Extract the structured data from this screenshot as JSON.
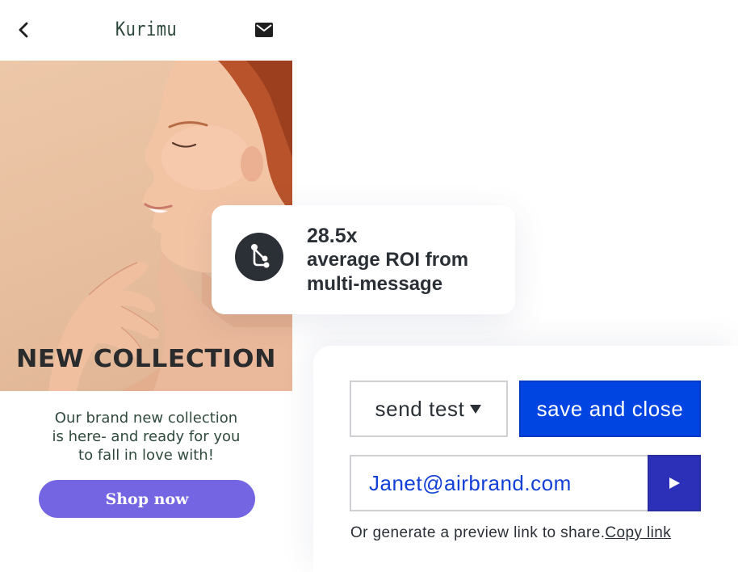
{
  "email_preview": {
    "brand": "Kurimu",
    "hero_title": "NEW COLLECTION",
    "body_lines": [
      "Our brand new collection",
      "is here- and ready for you",
      "to fall in love with!"
    ],
    "cta_label": "Shop now"
  },
  "roi_card": {
    "value": "28.5x",
    "description_lines": [
      "average ROI from",
      "multi-message"
    ]
  },
  "test_panel": {
    "send_test_label": "send test",
    "save_close_label": "save and close",
    "email_value": "Janet@airbrand.com",
    "preview_text": "Or generate a preview link to share.",
    "copy_link_label": "Copy link"
  },
  "icons": {
    "back": "chevron-left-icon",
    "mail": "envelope-icon",
    "roi": "branch-flow-icon",
    "dropdown": "caret-down-icon",
    "send": "play-icon"
  },
  "colors": {
    "primary_button": "#0044E2",
    "send_button": "#2C2FB8",
    "cta_button": "#7466E2",
    "brand_text": "#2F4A3D",
    "input_text": "#1240D6"
  }
}
